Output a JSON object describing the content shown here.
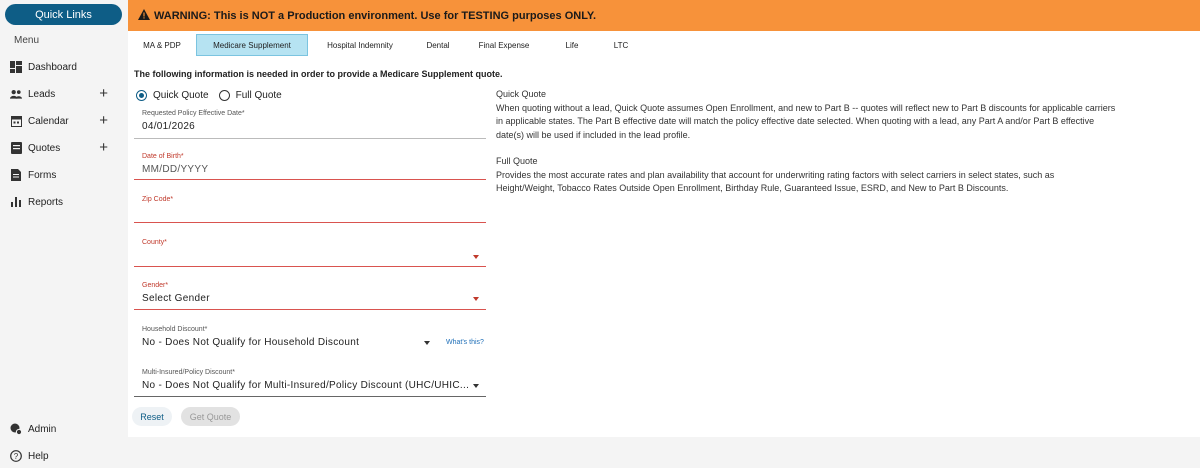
{
  "sidebar": {
    "quick_links": "Quick Links",
    "menu_label": "Menu",
    "items": [
      {
        "label": "Dashboard",
        "icon": "dashboard-icon",
        "expandable": false
      },
      {
        "label": "Leads",
        "icon": "people-icon",
        "expandable": true
      },
      {
        "label": "Calendar",
        "icon": "calendar-icon",
        "expandable": true
      },
      {
        "label": "Quotes",
        "icon": "quotes-icon",
        "expandable": true
      },
      {
        "label": "Forms",
        "icon": "document-icon",
        "expandable": false
      },
      {
        "label": "Reports",
        "icon": "bar-chart-icon",
        "expandable": false
      }
    ],
    "admin": "Admin",
    "help": "Help",
    "plus_glyph": "+"
  },
  "banner": {
    "text": "WARNING: This is NOT a Production environment. Use for TESTING purposes ONLY.",
    "color": "#f7923a"
  },
  "tabs": [
    {
      "label": "MA & PDP",
      "active": false
    },
    {
      "label": "Medicare Supplement",
      "active": true
    },
    {
      "label": "Hospital Indemnity",
      "active": false
    },
    {
      "label": "Dental",
      "active": false
    },
    {
      "label": "Final Expense",
      "active": false
    },
    {
      "label": "Life",
      "active": false
    },
    {
      "label": "LTC",
      "active": false
    }
  ],
  "form": {
    "intro": "The following information is needed in order to provide a Medicare Supplement quote.",
    "quote_type": {
      "options": [
        "Quick Quote",
        "Full Quote"
      ],
      "selected": "Quick Quote"
    },
    "effective_date": {
      "label": "Requested Policy Effective Date*",
      "value": "04/01/2026"
    },
    "dob": {
      "label": "Date of Birth*",
      "placeholder": "MM/DD/YYYY"
    },
    "zip": {
      "label": "Zip Code*",
      "value": ""
    },
    "county": {
      "label": "County*",
      "value": ""
    },
    "gender": {
      "label": "Gender*",
      "value": "Select Gender"
    },
    "household": {
      "label": "Household Discount*",
      "value": "No - Does Not Qualify for Household Discount",
      "help_link": "What's this?"
    },
    "multi_insured": {
      "label": "Multi-Insured/Policy Discount*",
      "value": "No - Does Not Qualify for Multi-Insured/Policy Discount (UHC/UHIC..."
    },
    "reset_label": "Reset",
    "get_quote_label": "Get Quote"
  },
  "info": {
    "quick_title": "Quick Quote",
    "quick_lines": [
      "When quoting without a lead, Quick Quote assumes Open Enrollment, and new to Part B -- quotes will reflect new to Part B discounts for applicable carriers",
      "in applicable states. The Part B effective date will match the policy effective date selected. When quoting with a lead, any Part A and/or Part B effective",
      "date(s) will be used if included in the lead profile."
    ],
    "full_title": "Full Quote",
    "full_lines": [
      "Provides the most accurate rates and plan availability that account for underwriting rating factors with select carriers in select states, such as",
      "Height/Weight, Tobacco Rates Outside Open Enrollment, Birthday Rule, Guaranteed Issue, ESRD, and New to Part B Discounts."
    ]
  },
  "colors": {
    "accent": "#0e5d86",
    "active_tab": "#b6e3f2",
    "error": "#d9534f"
  }
}
